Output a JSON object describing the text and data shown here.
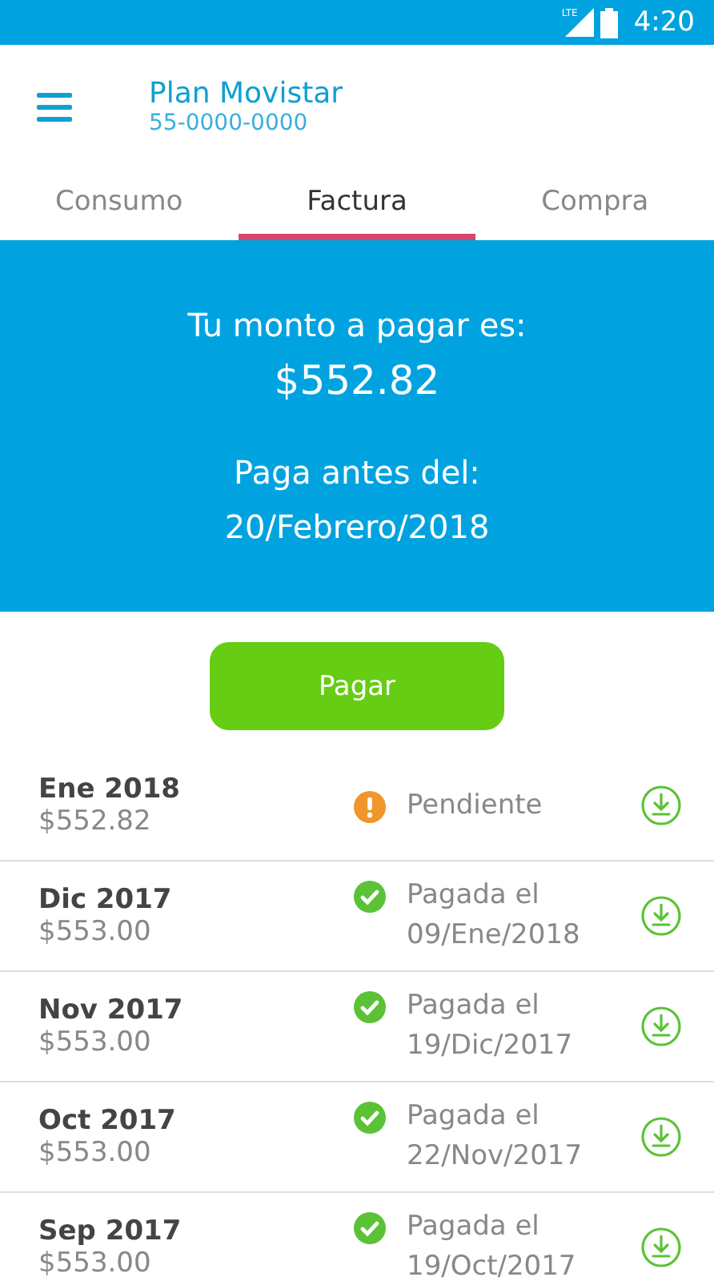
{
  "status_bar": {
    "network": "LTE",
    "time": "4:20"
  },
  "header": {
    "title": "Plan Movistar",
    "subtitle": "55-0000-0000"
  },
  "tabs": [
    {
      "label": "Consumo",
      "selected": false
    },
    {
      "label": "Factura",
      "selected": true
    },
    {
      "label": "Compra",
      "selected": false
    }
  ],
  "summary": {
    "amount_label": "Tu monto a pagar es:",
    "amount": "$552.82",
    "due_label": "Paga antes del:",
    "due_date": "20/Febrero/2018"
  },
  "pay_button": "Pagar",
  "bills": [
    {
      "month": "Ene 2018",
      "amount": "$552.82",
      "kind": "pending",
      "status": "Pendiente"
    },
    {
      "month": "Dic 2017",
      "amount": "$553.00",
      "kind": "paid",
      "status": "Pagada el",
      "date": "09/Ene/2018"
    },
    {
      "month": "Nov 2017",
      "amount": "$553.00",
      "kind": "paid",
      "status": "Pagada el",
      "date": "19/Dic/2017"
    },
    {
      "month": "Oct 2017",
      "amount": "$553.00",
      "kind": "paid",
      "status": "Pagada el",
      "date": "22/Nov/2017"
    },
    {
      "month": "Sep 2017",
      "amount": "$553.00",
      "kind": "paid",
      "status": "Pagada el",
      "date": "19/Oct/2017"
    }
  ]
}
